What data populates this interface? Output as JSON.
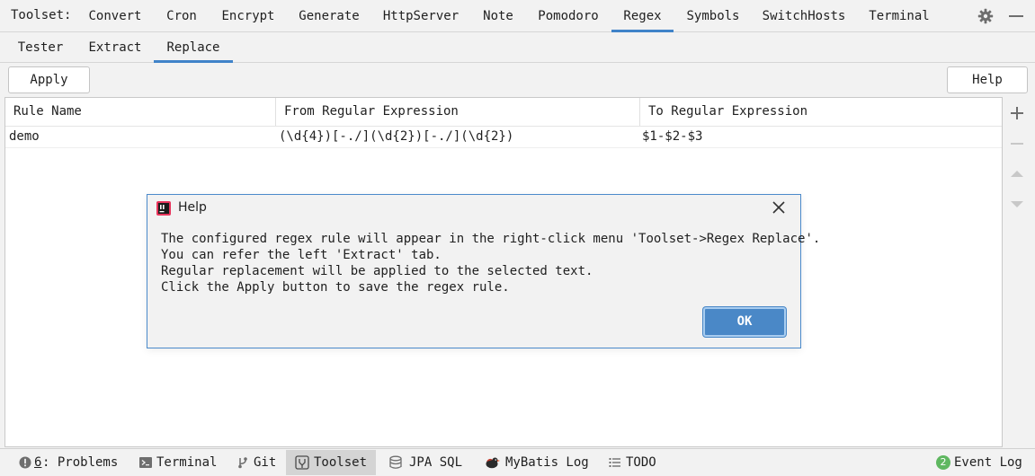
{
  "topbar": {
    "label": "Toolset:",
    "tabs": [
      {
        "label": "Convert"
      },
      {
        "label": "Cron"
      },
      {
        "label": "Encrypt"
      },
      {
        "label": "Generate"
      },
      {
        "label": "HttpServer"
      },
      {
        "label": "Note"
      },
      {
        "label": "Pomodoro"
      },
      {
        "label": "Regex",
        "active": true
      },
      {
        "label": "Symbols"
      },
      {
        "label": "SwitchHosts"
      },
      {
        "label": "Terminal"
      }
    ],
    "icons": [
      "gear-icon",
      "minimize-icon"
    ]
  },
  "subtabs": [
    {
      "label": "Tester"
    },
    {
      "label": "Extract"
    },
    {
      "label": "Replace",
      "active": true
    }
  ],
  "toolbar": {
    "apply_label": "Apply",
    "help_label": "Help"
  },
  "table": {
    "columns": [
      "Rule Name",
      "From Regular Expression",
      "To Regular Expression"
    ],
    "rows": [
      {
        "name": "demo",
        "from": "(\\d{4})[-./](\\d{2})[-./](\\d{2})",
        "to": "$1-$2-$3"
      }
    ],
    "side_icons": [
      "add-icon",
      "remove-icon",
      "move-up-icon",
      "move-down-icon"
    ]
  },
  "dialog": {
    "title": "Help",
    "lines": [
      "The configured regex rule will appear in the right-click menu 'Toolset->Regex Replace'.",
      "You can refer the left 'Extract' tab.",
      "Regular replacement will be applied to the selected text.",
      "Click the Apply button to save the regex rule."
    ],
    "ok_label": "OK"
  },
  "bottombar": {
    "items": [
      {
        "prefix": "6",
        "label": ": Problems",
        "icon": "problems-icon"
      },
      {
        "label": "Terminal",
        "icon": "terminal-icon"
      },
      {
        "label": "Git",
        "icon": "git-icon"
      },
      {
        "label": "Toolset",
        "icon": "toolset-icon",
        "active": true
      },
      {
        "label": "JPA SQL",
        "icon": "database-icon"
      },
      {
        "label": "MyBatis Log",
        "icon": "mybatis-bird-icon"
      },
      {
        "label": "TODO",
        "icon": "todo-list-icon"
      }
    ],
    "event_log": {
      "count": "2",
      "label": "Event Log"
    }
  },
  "colors": {
    "accent": "#4083c9",
    "ok_button": "#4a88c7",
    "dialog_border": "#4b8acb",
    "badge": "#5fb760"
  }
}
